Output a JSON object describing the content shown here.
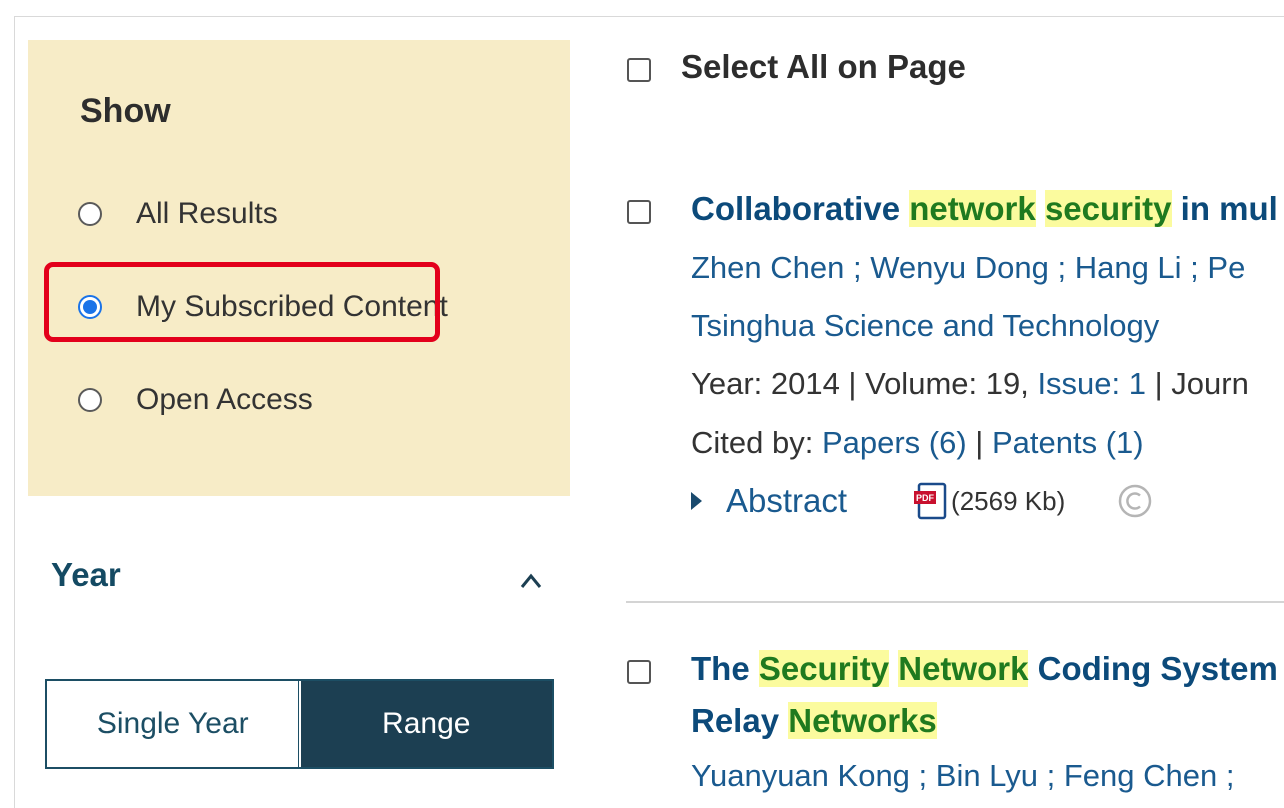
{
  "filters": {
    "show": {
      "title": "Show",
      "options": [
        {
          "label": "All Results",
          "checked": false
        },
        {
          "label": "My Subscribed Content",
          "checked": true
        },
        {
          "label": "Open Access",
          "checked": false
        }
      ]
    },
    "year": {
      "title": "Year",
      "modes": [
        "Single Year",
        "Range"
      ],
      "active_mode": "Range"
    }
  },
  "results": {
    "select_all_label": "Select All on Page",
    "items": [
      {
        "title_parts": [
          {
            "text": "Collaborative ",
            "highlight": false
          },
          {
            "text": "network",
            "highlight": true
          },
          {
            "text": " ",
            "highlight": false
          },
          {
            "text": "security",
            "highlight": true
          },
          {
            "text": " in mul",
            "highlight": false
          }
        ],
        "authors": "Zhen Chen ; Wenyu Dong ; Hang Li ; Pe",
        "publication": "Tsinghua Science and Technology",
        "year_label": "Year: 2014 | Volume: 19, ",
        "issue_label": "Issue: 1",
        "journal_label": " | Journ",
        "cited_by_label": "Cited by: ",
        "papers_label": "Papers (6)",
        "separator": " | ",
        "patents_label": "Patents (1)",
        "abstract_label": "Abstract",
        "pdf_size": "(2569 Kb)"
      },
      {
        "title_line1_parts": [
          {
            "text": "The ",
            "highlight": false
          },
          {
            "text": "Security",
            "highlight": true
          },
          {
            "text": " ",
            "highlight": false
          },
          {
            "text": "Network",
            "highlight": true
          },
          {
            "text": " Coding System",
            "highlight": false
          }
        ],
        "title_line2_parts": [
          {
            "text": "Relay ",
            "highlight": false
          },
          {
            "text": "Networks",
            "highlight": true
          }
        ],
        "authors": "Yuanyuan Kong ; Bin Lyu ; Feng Chen ;"
      }
    ]
  },
  "colors": {
    "show_panel_bg": "#f7ecc7",
    "highlight_bg": "#fbfb9e",
    "annotation_red": "#e3001b",
    "range_active_bg": "#1c3f52",
    "link_blue": "#1a5a8f"
  }
}
